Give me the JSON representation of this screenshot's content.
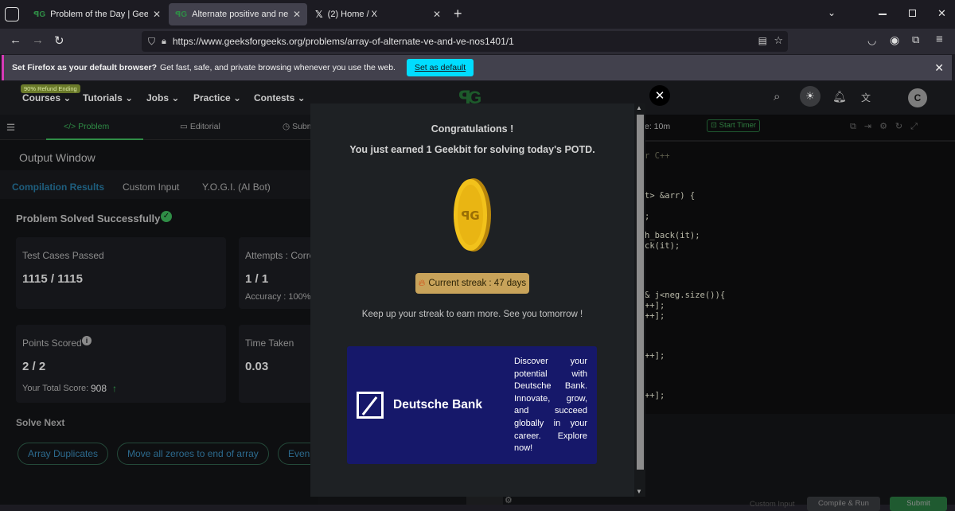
{
  "browser": {
    "tabs": [
      {
        "title": "Problem of the Day | GeeksforG",
        "active": false
      },
      {
        "title": "Alternate positive and negative",
        "active": true
      },
      {
        "title": "(2) Home / X",
        "active": false
      }
    ],
    "url": "https://www.geeksforgeeks.org/problems/array-of-alternate-ve-and-ve-nos1401/1",
    "notification": {
      "bold": "Set Firefox as your default browser?",
      "text": "Get fast, safe, and private browsing whenever you use the web.",
      "button": "Set as default"
    }
  },
  "nav": {
    "badge": "90% Refund Ending",
    "items": [
      "Courses",
      "Tutorials",
      "Jobs",
      "Practice",
      "Contests"
    ],
    "avatar": "C"
  },
  "subnav": {
    "problem": "</> Problem",
    "editorial": "Editorial",
    "submissions": "Subm",
    "timer_text": "e: 10m",
    "start_timer": "Start Timer"
  },
  "output": {
    "title": "Output Window",
    "tabs": [
      "Compilation Results",
      "Custom Input",
      "Y.O.G.I. (AI Bot)"
    ],
    "status": "Problem Solved Successfully",
    "test_cases_label": "Test Cases Passed",
    "test_cases_value": "1115 / 1115",
    "attempts_label": "Attempts : Corre",
    "attempts_value": "1 / 1",
    "accuracy": "Accuracy : 100%",
    "points_label": "Points Scored",
    "points_value": "2 / 2",
    "total_score_label": "Your Total Score:",
    "total_score_value": "908",
    "time_label": "Time Taken",
    "time_value": "0.03",
    "solve_next": "Solve Next",
    "next_chips": [
      "Array Duplicates",
      "Move all zeroes to end of array",
      "Even"
    ]
  },
  "editor": {
    "lang_hint": "r C++",
    "lines": [
      "t> &arr) {",
      ";",
      "h_back(it);",
      "ck(it);",
      "& j<neg.size()){",
      "++];",
      "++];",
      "++];",
      "++];"
    ],
    "bottom_buttons": [
      "Custom Input",
      "Compile & Run",
      "Submit"
    ]
  },
  "modal": {
    "heading": "Congratulations !",
    "earned": "You just earned 1 Geekbit for solving today's POTD.",
    "streak": "Current streak : 47 days",
    "streak_icon": "fire-icon",
    "encourage": "Keep up your streak to earn more. See you tomorrow !",
    "close": "✕",
    "ad": {
      "brand": "Deutsche Bank",
      "copy": "Discover your potential with Deutsche Bank. Innovate, grow, and succeed globally in your career. Explore now!"
    }
  },
  "colors": {
    "accent_green": "#2f8d46",
    "coin_gold": "#f2c21b",
    "streak_bg": "#c8a35a",
    "ad_bg": "#16186a",
    "firefox_button": "#00ddff"
  }
}
